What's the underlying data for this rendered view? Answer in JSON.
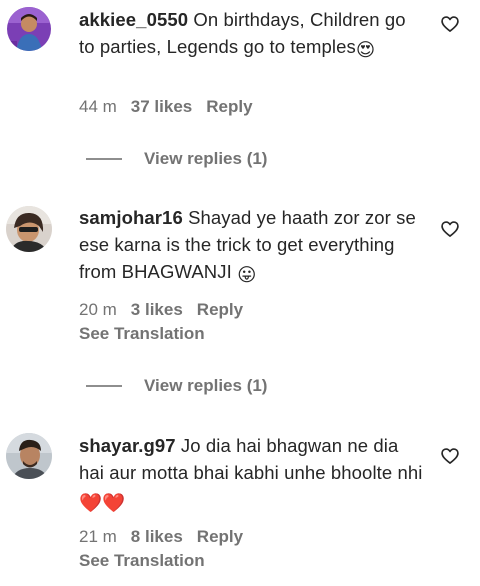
{
  "comments": [
    {
      "username": "akkiee_0550",
      "text": "On birthdays, Children go to parties, Legends go to temples",
      "emoji": "😍",
      "time": "44 m",
      "likes": "37 likes",
      "reply": "Reply",
      "view_replies": "View replies (1)",
      "avatar_icon": "profile-photo-icon"
    },
    {
      "username": "samjohar16",
      "text": "Shayad ye haath zor zor se ese karna is the trick to get everything from BHAGWANJI",
      "emoji": "😛",
      "time": "20 m",
      "likes": "3 likes",
      "reply": "Reply",
      "translation": "See Translation",
      "view_replies": "View replies (1)",
      "avatar_icon": "profile-photo-icon"
    },
    {
      "username": "shayar.g97",
      "text": "Jo dia hai bhagwan ne dia hai aur motta bhai kabhi unhe bhoolte nhi",
      "emoji": "❤️❤️",
      "time": "21 m",
      "likes": "8 likes",
      "reply": "Reply",
      "translation": "See Translation",
      "avatar_icon": "profile-photo-icon"
    }
  ],
  "colors": {
    "text_primary": "#262626",
    "text_secondary": "#737373",
    "background": "#ffffff"
  }
}
